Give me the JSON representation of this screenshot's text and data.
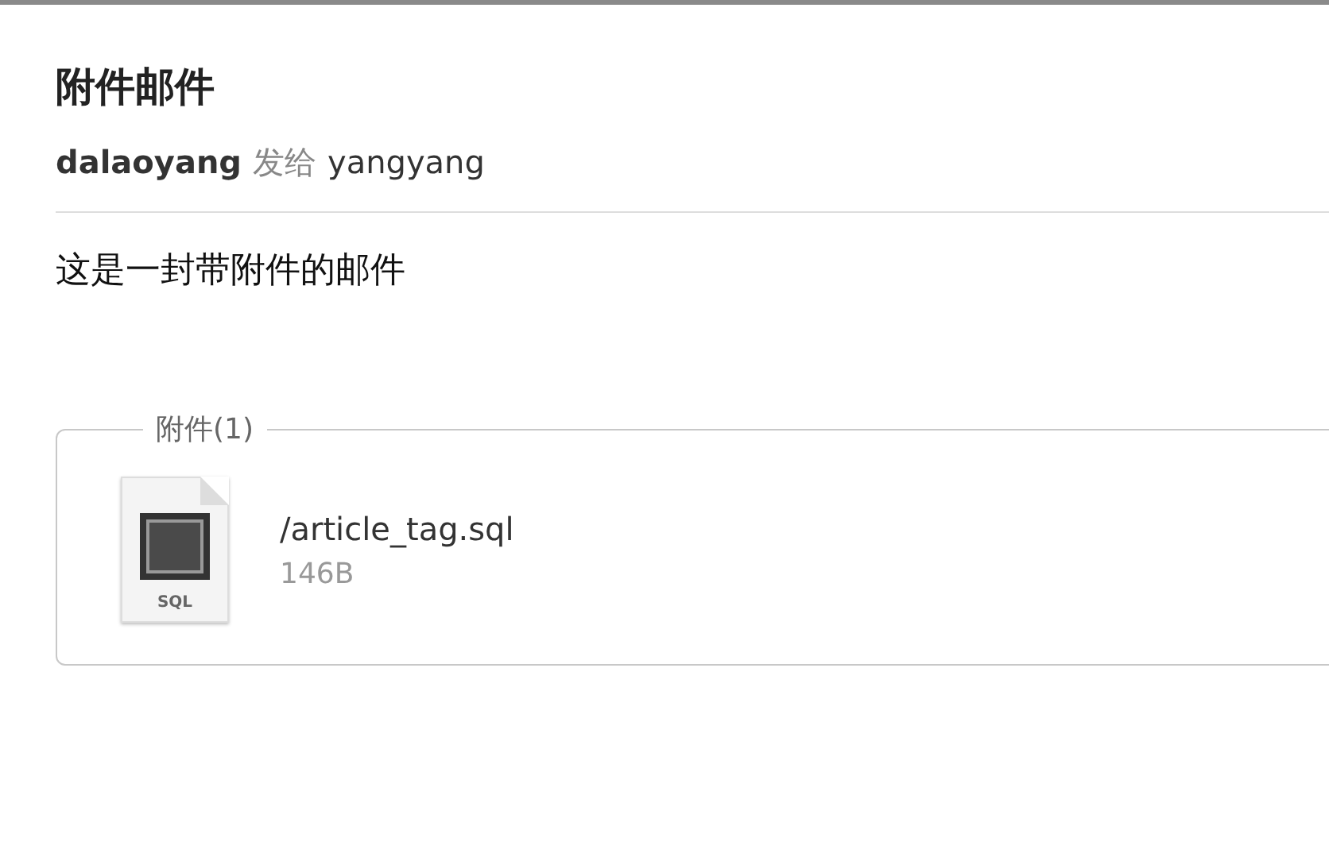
{
  "title": "附件邮件",
  "sender": {
    "from": "dalaoyang",
    "verb": "发给",
    "to": "yangyang"
  },
  "body": "这是一封带附件的邮件",
  "attachments": {
    "legend": "附件(1)",
    "files": [
      {
        "icon_label": "SQL",
        "name": "/article_tag.sql",
        "size": "146B"
      }
    ]
  }
}
